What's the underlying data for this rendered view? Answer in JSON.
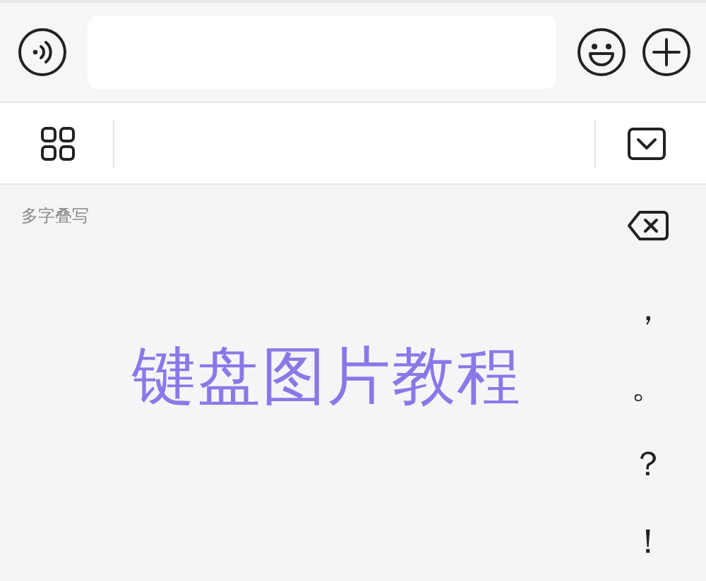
{
  "handwriting": {
    "mode_label": "多字叠写",
    "overlay_title": "键盘图片教程"
  },
  "punctuation_keys": [
    {
      "label": "，"
    },
    {
      "label": "。"
    },
    {
      "label": "？"
    },
    {
      "label": "！"
    }
  ]
}
